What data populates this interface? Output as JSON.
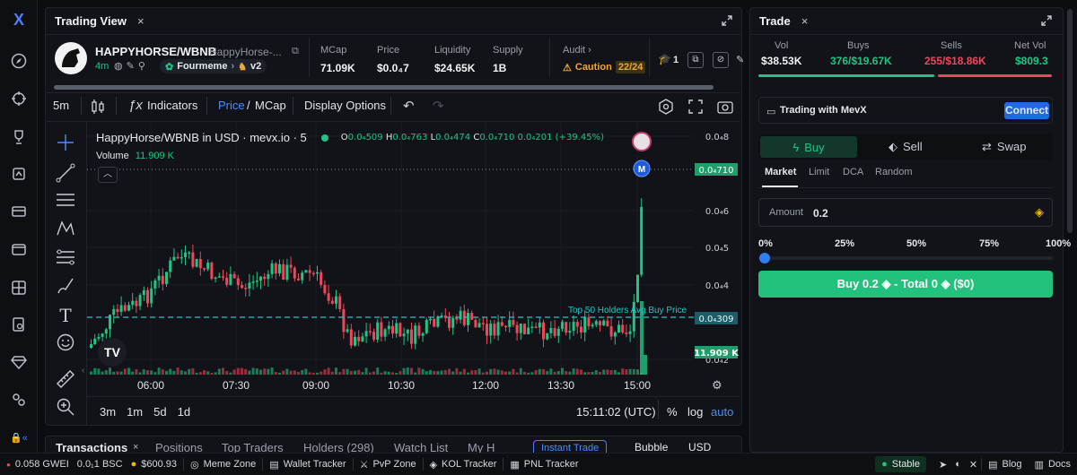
{
  "app": {
    "logo": "X"
  },
  "tv": {
    "tab_title": "Trading View",
    "token": {
      "name": "HAPPYHORSE/WBNB",
      "sub": "HappyHorse-...",
      "age": "4m",
      "launchpad": "Fourmeme",
      "version": "v2"
    },
    "stats": [
      {
        "label": "MCap",
        "value": "71.09K"
      },
      {
        "label": "Price",
        "value": "$0.0₄7"
      },
      {
        "label": "Liquidity",
        "value": "$24.65K"
      },
      {
        "label": "Supply",
        "value": "1B"
      }
    ],
    "audit": {
      "label": "Audit",
      "status": "Caution",
      "score": "22/24"
    },
    "badge_count": "1",
    "toolbar": {
      "interval": "5m",
      "indicators": "Indicators",
      "price": "Price",
      "sep": "/",
      "mcap": "MCap",
      "display": "Display Options"
    },
    "legend": {
      "title": "HappyHorse/WBNB in USD · mevx.io · 5",
      "o_lbl": "O",
      "o": "0.0₄509",
      "h_lbl": "H",
      "h": "0.0₄763",
      "l_lbl": "L",
      "l": "0.0₄474",
      "c_lbl": "C",
      "c": "0.0₄710",
      "chg": "0.0₄201 (+39.45%)",
      "vol_lbl": "Volume",
      "vol": "11.909 K"
    },
    "axis": {
      "y": [
        "0.0₄8",
        "0.0₄6",
        "0.0₄5",
        "0.0₄4",
        "0.0₄2"
      ],
      "x": [
        "06:00",
        "07:30",
        "09:00",
        "10:30",
        "12:00",
        "13:30",
        "15:00"
      ],
      "price_tag": "0.0₄710",
      "avg_tag": "0.0₄309",
      "vol_tag": "11.909 K",
      "avg_label": "Top 50 Holders Avg Buy Price",
      "marker": "M"
    },
    "bottom": {
      "ranges": [
        "3m",
        "1m",
        "5d",
        "1d"
      ],
      "time": "15:11:02 (UTC)",
      "pct": "%",
      "log": "log",
      "auto": "auto"
    }
  },
  "tabs_below": [
    "Transactions",
    "Positions",
    "Top Traders",
    "Holders (298)",
    "Watch List",
    "My H",
    "Instant Trade",
    "Bubble",
    "USD"
  ],
  "trade": {
    "tab_title": "Trade",
    "stats": {
      "vol_lbl": "Vol",
      "vol": "$38.53K",
      "buys_lbl": "Buys",
      "buys": "376/$19.67K",
      "sells_lbl": "Sells",
      "sells": "255/$18.86K",
      "net_lbl": "Net Vol",
      "net": "$809.3"
    },
    "wallet_text": "Trading with MevX",
    "connect": "Connect",
    "modes": [
      "Buy",
      "Sell",
      "Swap"
    ],
    "order_types": [
      "Market",
      "Limit",
      "DCA",
      "Random"
    ],
    "amount_lbl": "Amount",
    "amount": "0.2",
    "pcts": [
      "0%",
      "25%",
      "50%",
      "75%",
      "100%"
    ],
    "slider_fraction": 0,
    "buy_btn": "Buy 0.2 ◈ - Total 0 ◈ ($0)"
  },
  "status": {
    "gwei": "0.058 GWEI",
    "bsc": "0.0₁1 BSC",
    "bnb": "$600.93",
    "links": [
      "Meme Zone",
      "Wallet Tracker",
      "PvP Zone",
      "KOL Tracker",
      "PNL Tracker"
    ],
    "stable": "Stable",
    "blog": "Blog",
    "docs": "Docs"
  },
  "colors": {
    "up": "#1fc584",
    "down": "#f0455b",
    "accent": "#23c6c8",
    "brand": "#1f5bd8"
  }
}
